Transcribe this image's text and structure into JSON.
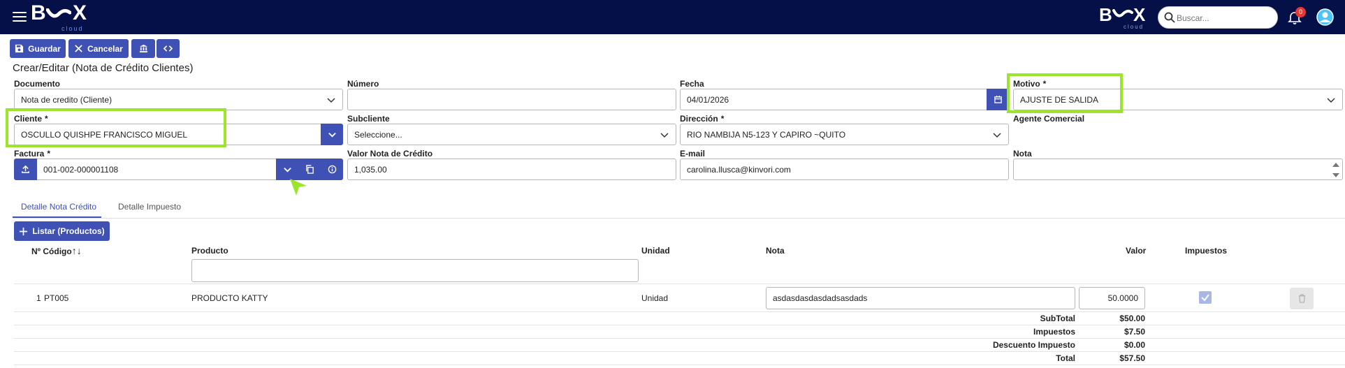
{
  "header": {
    "logo_left": "B",
    "logo_left_end": "X",
    "logo_left_sub": "cloud",
    "logo_right": "B",
    "logo_right_end": "X",
    "logo_right_sub": "cloud",
    "search_placeholder": "Buscar...",
    "notification_count": "0"
  },
  "toolbar": {
    "save_label": "Guardar",
    "cancel_label": "Cancelar"
  },
  "page_title": "Crear/Editar (Nota de Crédito Clientes)",
  "form": {
    "documento": {
      "label": "Documento",
      "value": "Nota de credito (Cliente)"
    },
    "numero": {
      "label": "Número",
      "value": ""
    },
    "fecha": {
      "label": "Fecha",
      "value": "04/01/2026"
    },
    "motivo": {
      "label": "Motivo",
      "required": "*",
      "value": "AJUSTE DE SALIDA"
    },
    "cliente": {
      "label": "Cliente",
      "required": "*",
      "value": "OSCULLO QUISHPE FRANCISCO MIGUEL"
    },
    "subcliente": {
      "label": "Subcliente",
      "value": "Seleccione..."
    },
    "direccion": {
      "label": "Dirección",
      "required": "*",
      "value": "RIO NAMBIJA N5-123 Y CAPIRO ~QUITO"
    },
    "agente": {
      "label": "Agente Comercial"
    },
    "factura": {
      "label": "Factura",
      "required": "*",
      "value": "001-002-000001108"
    },
    "valor": {
      "label": "Valor Nota de Crédito",
      "value": "1,035.00"
    },
    "email": {
      "label": "E-mail",
      "value": "carolina.llusca@kinvori.com"
    },
    "nota": {
      "label": "Nota",
      "value": ""
    }
  },
  "tabs": [
    {
      "label": "Detalle Nota Crédito",
      "active": true
    },
    {
      "label": "Detalle Impuesto",
      "active": false
    }
  ],
  "list_button_label": "Listar (Productos)",
  "table": {
    "headers": {
      "codigo": "Nº Código",
      "sort_glyph": "↑↓",
      "producto": "Producto",
      "unidad": "Unidad",
      "nota": "Nota",
      "valor": "Valor",
      "impuestos": "Impuestos"
    },
    "filter_value": "",
    "rows": [
      {
        "index": "1",
        "codigo": "PT005",
        "producto": "PRODUCTO KATTY",
        "unidad": "Unidad",
        "nota": "asdasdasdasdadsasdads",
        "valor": "50.0000",
        "impuestos": true
      }
    ]
  },
  "totals": [
    {
      "label": "SubTotal",
      "value": "$50.00"
    },
    {
      "label": "Impuestos",
      "value": "$7.50"
    },
    {
      "label": "Descuento Impuesto",
      "value": "$0.00"
    },
    {
      "label": "Total",
      "value": "$57.50"
    }
  ],
  "colors": {
    "topbar": "#061048",
    "primary": "#3f51b5",
    "highlight": "#9be52a",
    "badge": "#e53935"
  }
}
